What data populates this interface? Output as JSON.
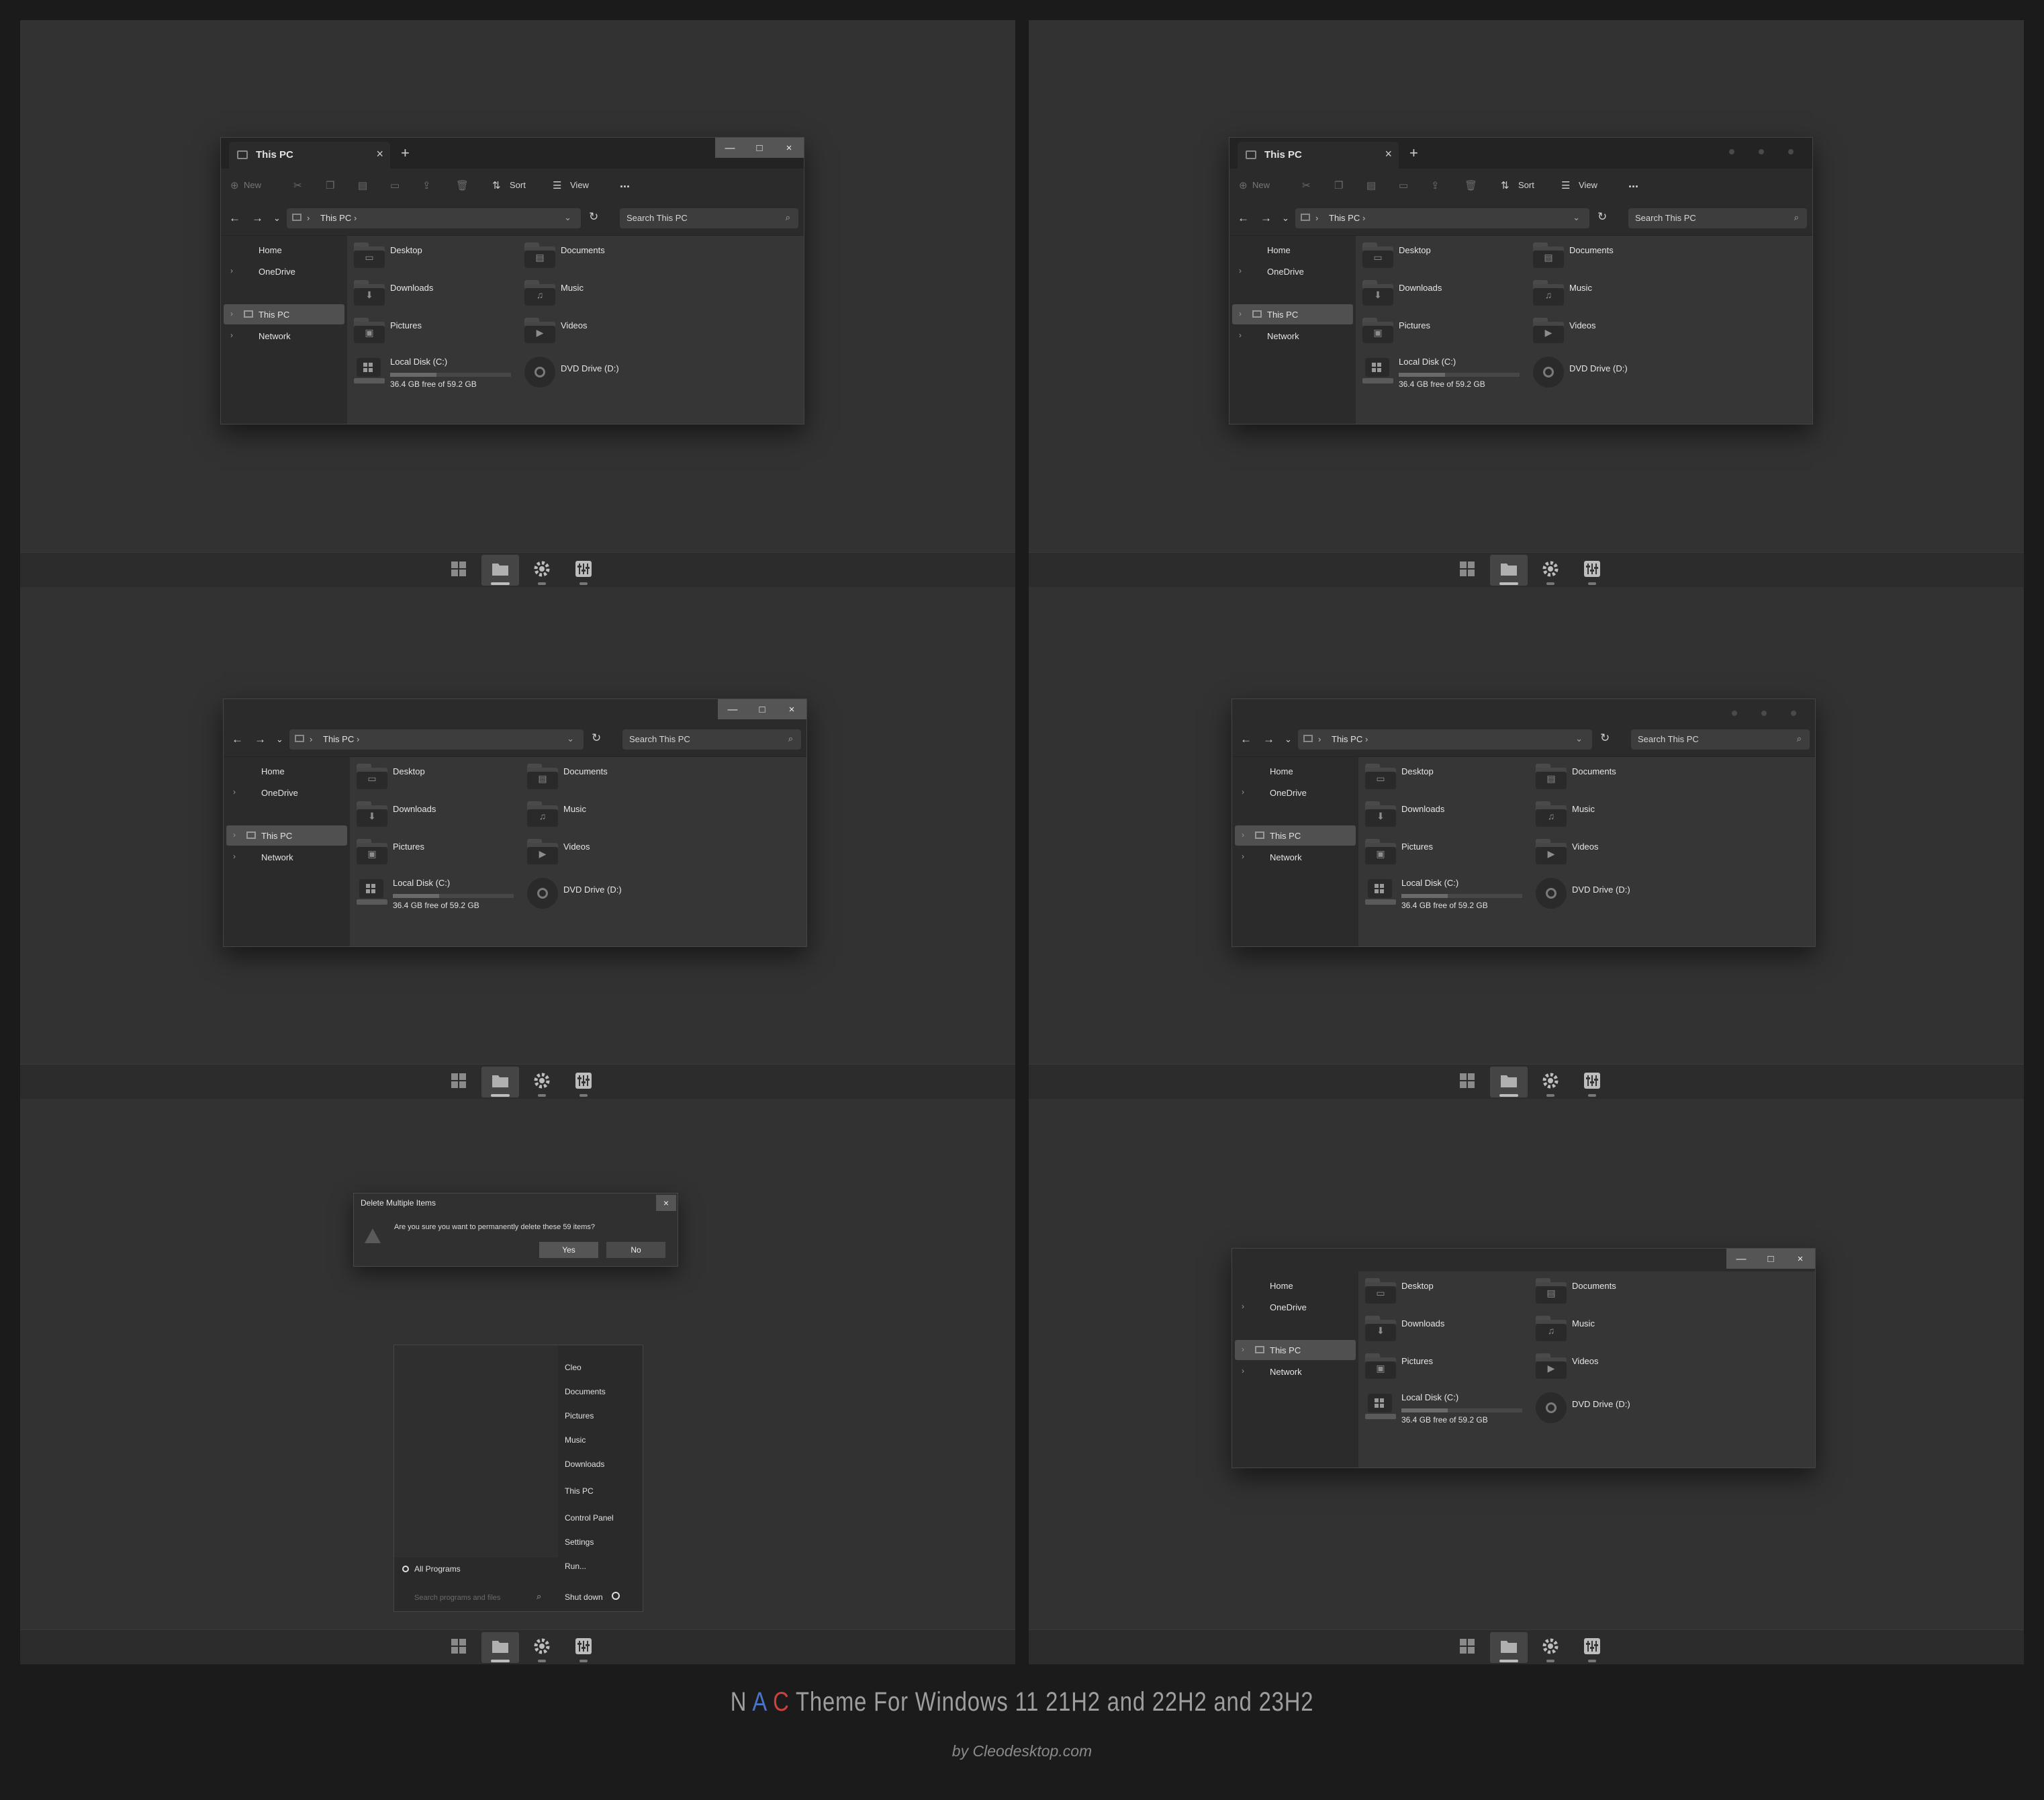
{
  "explorer": {
    "tab_title": "This PC",
    "toolbar": {
      "new": "New",
      "sort": "Sort",
      "view": "View",
      "more": "..."
    },
    "address": {
      "crumb": "This PC",
      "search_placeholder": "Search This PC"
    },
    "sidebar": [
      "Home",
      "OneDrive",
      "This PC",
      "Network"
    ],
    "folders": [
      {
        "name": "Desktop",
        "glyph": "▭"
      },
      {
        "name": "Documents",
        "glyph": "▤"
      },
      {
        "name": "Downloads",
        "glyph": "⬇"
      },
      {
        "name": "Music",
        "glyph": "♫"
      },
      {
        "name": "Pictures",
        "glyph": "▣"
      },
      {
        "name": "Videos",
        "glyph": "▶"
      }
    ],
    "drives": {
      "local_name": "Local Disk (C:)",
      "local_free": "36.4 GB free of 59.2 GB",
      "local_used_fraction": 0.385,
      "dvd_name": "DVD Drive (D:)"
    }
  },
  "dialog": {
    "title": "Delete Multiple Items",
    "message": "Are you sure you want to permanently delete these 59 items?",
    "yes": "Yes",
    "no": "No",
    "close": "×"
  },
  "start_menu": {
    "right_items": [
      "Cleo",
      "Documents",
      "Pictures",
      "Music",
      "Downloads",
      "This PC",
      "Control Panel",
      "Settings",
      "Run..."
    ],
    "all_programs": "All Programs",
    "search_placeholder": "Search programs and files",
    "shutdown": "Shut down"
  },
  "taskbar": {
    "icons": [
      "start-icon",
      "file-explorer-icon",
      "settings-icon",
      "control-panel-icon"
    ]
  },
  "caption": {
    "letters": [
      "N",
      "A",
      "C"
    ],
    "letter_colors": [
      "#9e9e9e",
      "#4a74c9",
      "#c94141"
    ],
    "rest": "Theme For Windows 11 21H2 and 22H2 and 23H2",
    "credit": "by Cleodesktop.com"
  }
}
